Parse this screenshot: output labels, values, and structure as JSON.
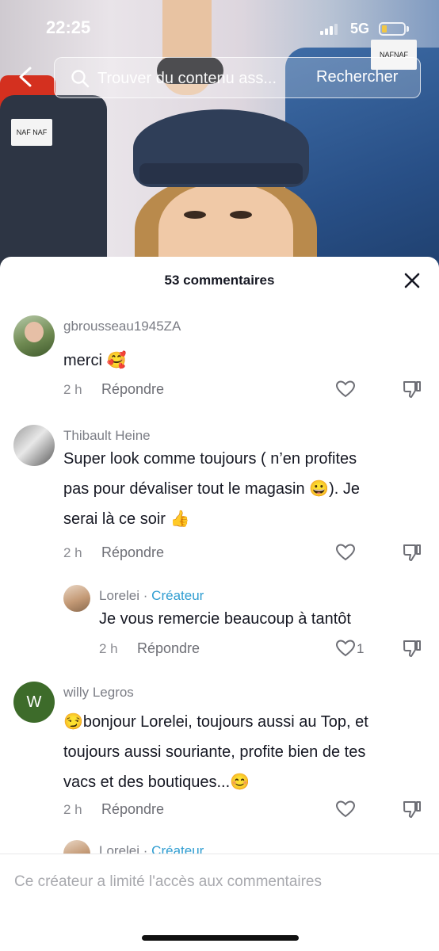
{
  "status_bar": {
    "time": "22:25",
    "network": "5G"
  },
  "video": {
    "tag_left": "NAF NAF",
    "tag_right": "NAFNAF"
  },
  "search": {
    "placeholder": "Trouver du contenu ass...",
    "button_label": "Rechercher"
  },
  "comments_sheet": {
    "title": "53 commentaires",
    "reply_label": "Répondre",
    "creator_label": "Créateur",
    "comments": [
      {
        "user": "gbrousseau1945ZA",
        "lines": [
          "merci 🥰"
        ],
        "time": "2 h"
      },
      {
        "user": "Thibault Heine",
        "lines": [
          "Super look comme toujours ( n’en profites",
          "pas pour dévaliser tout le magasin 😀). Je",
          "serai là ce soir 👍"
        ],
        "time": "2 h"
      },
      {
        "user": "Lorelei",
        "lines": [
          "Je vous remercie beaucoup à tantôt"
        ],
        "time": "2 h",
        "likes": "1"
      },
      {
        "user": "willy Legros",
        "avatar_letter": "W",
        "lines": [
          "😏bonjour Lorelei, toujours aussi au Top, et",
          "toujours aussi souriante, profite bien de tes",
          "vacs et des boutiques...😊"
        ],
        "time": "2 h"
      },
      {
        "user": "Lorelei"
      }
    ]
  },
  "footer": {
    "text": "Ce créateur a limité l'accès aux commentaires"
  },
  "colors": {
    "creator": "#2f9dd1",
    "willy_avatar": "#3d6b2a"
  }
}
